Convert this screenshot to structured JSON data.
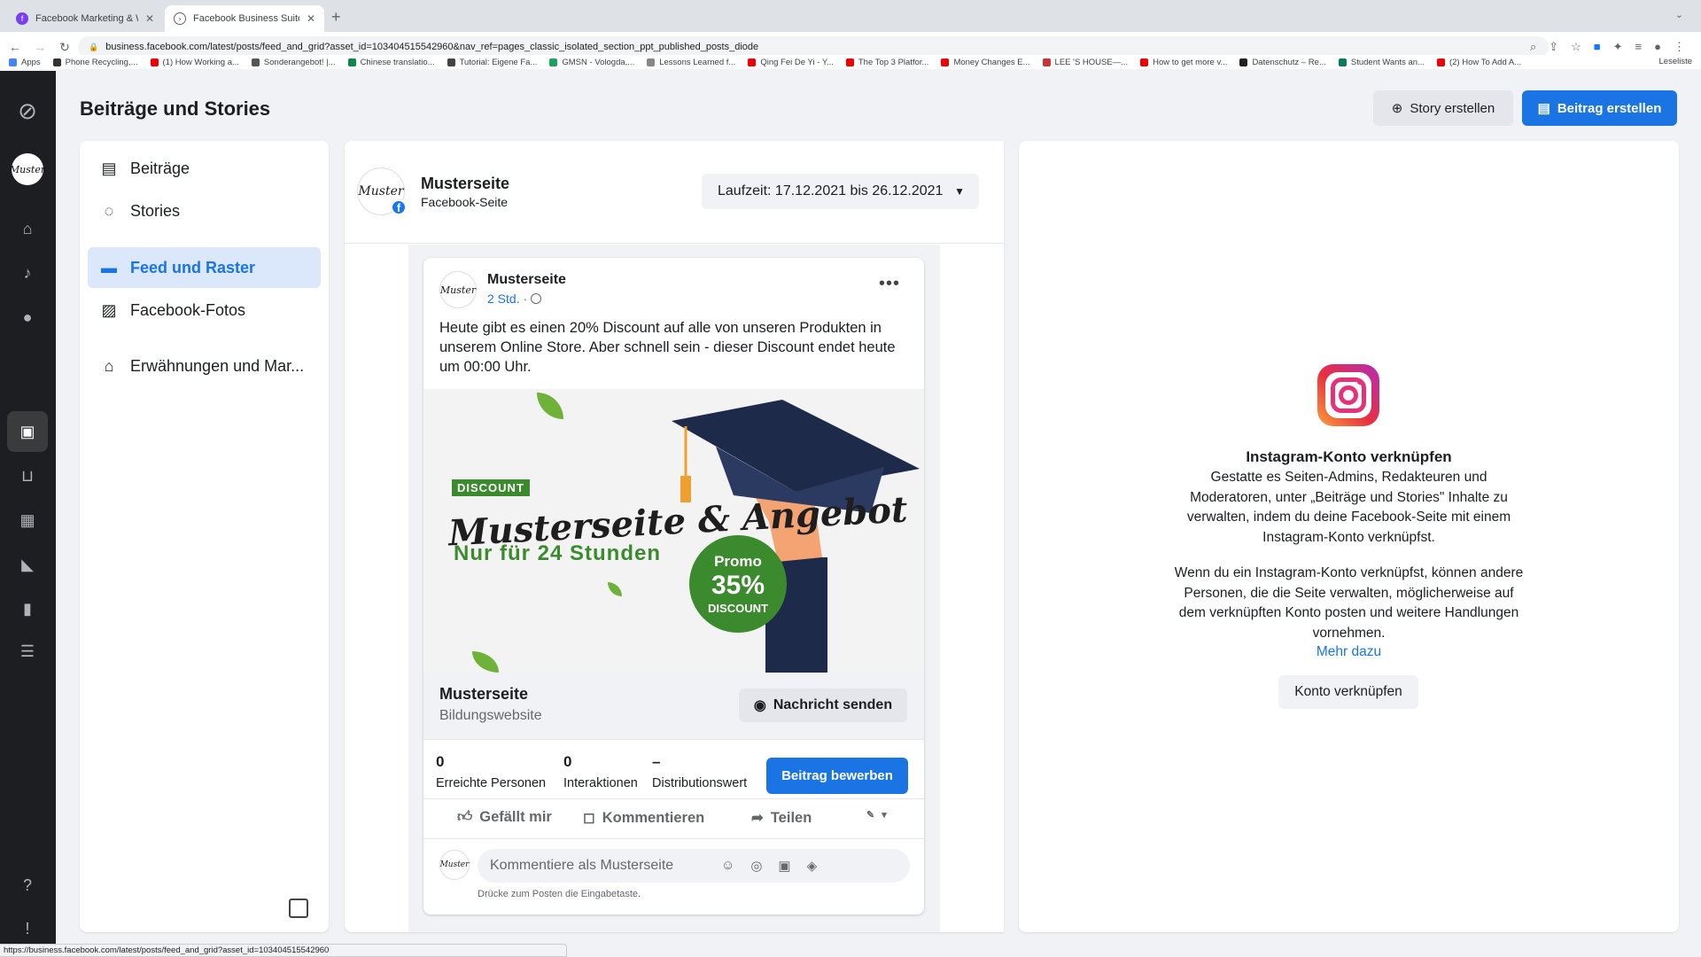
{
  "browser": {
    "tabs": [
      {
        "title": "Facebook Marketing & Werbea",
        "active": false
      },
      {
        "title": "Facebook Business Suite",
        "active": true
      }
    ],
    "url": "business.facebook.com/latest/posts/feed_and_grid?asset_id=103404515542960&nav_ref=pages_classic_isolated_section_ppt_published_posts_diode",
    "bookmarks": [
      "Apps",
      "Phone Recycling,...",
      "(1) How Working a...",
      "Sonderangebot! |...",
      "Chinese translatio...",
      "Tutorial: Eigene Fa...",
      "GMSN - Vologda,...",
      "Lessons Learned f...",
      "Qing Fei De Yi - Y...",
      "The Top 3 Platfor...",
      "Money Changes E...",
      "LEE 'S HOUSE—...",
      "How to get more v...",
      "Datenschutz – Re...",
      "Student Wants an...",
      "(2) How To Add A..."
    ],
    "reading_list": "Leseliste",
    "status_url": "https://business.facebook.com/latest/posts/feed_and_grid?asset_id=103404515542960"
  },
  "header": {
    "title": "Beiträge und Stories",
    "story_button": "Story erstellen",
    "post_button": "Beitrag erstellen"
  },
  "sidebar": {
    "items": [
      {
        "label": "Beiträge",
        "icon": "posts-icon"
      },
      {
        "label": "Stories",
        "icon": "stories-icon"
      },
      {
        "label": "Feed und Raster",
        "icon": "feed-grid-icon",
        "selected": true
      },
      {
        "label": "Facebook-Fotos",
        "icon": "photos-icon"
      },
      {
        "label": "Erwähnungen und Mar...",
        "icon": "tag-icon"
      }
    ]
  },
  "feed": {
    "page_name": "Musterseite",
    "page_type": "Facebook-Seite",
    "date_range": "Laufzeit: 17.12.2021 bis 26.12.2021",
    "avatar_text": "Muster"
  },
  "post": {
    "author": "Musterseite",
    "time": "2 Std.",
    "separator": "·",
    "text": "Heute gibt es einen 20% Discount auf alle von unseren Produkten in unserem Online Store. Aber schnell sein - dieser Discount endet heute um 00:00 Uhr.",
    "image": {
      "tag": "DISCOUNT",
      "headline": "Musterseite & Angebot",
      "subline": "Nur für 24 Stunden",
      "promo_line1": "Promo",
      "promo_line2": "35%",
      "promo_line3": "DISCOUNT"
    },
    "cta": {
      "name": "Musterseite",
      "subtitle": "Bildungswebsite",
      "button": "Nachricht senden"
    },
    "stats": [
      {
        "value": "0",
        "label": "Erreichte Personen"
      },
      {
        "value": "0",
        "label": "Interaktionen"
      },
      {
        "value": "–",
        "label": "Distributionswert"
      }
    ],
    "boost_button": "Beitrag bewerben",
    "actions": {
      "like": "Gefällt mir",
      "comment": "Kommentieren",
      "share": "Teilen"
    },
    "comment_placeholder": "Kommentiere als Musterseite",
    "comment_hint": "Drücke zum Posten die Eingabetaste."
  },
  "instagram": {
    "title": "Instagram-Konto verknüpfen",
    "para1": "Gestatte es Seiten-Admins, Redakteuren und Moderatoren, unter „Beiträge und Stories\" Inhalte zu verwalten, indem du deine Facebook-Seite mit einem Instagram-Konto verknüpfst.",
    "para2": "Wenn du ein Instagram-Konto verknüpfst, können andere Personen, die die Seite verwalten, möglicherweise auf dem verknüpften Konto posten und weitere Handlungen vornehmen.",
    "link": "Mehr dazu",
    "button": "Konto verknüpfen"
  },
  "colors": {
    "accent": "#1b74e4",
    "selected_bg": "#dbe7fa",
    "rail": "#1c1e21",
    "promo_green": "#3c8a2e"
  }
}
